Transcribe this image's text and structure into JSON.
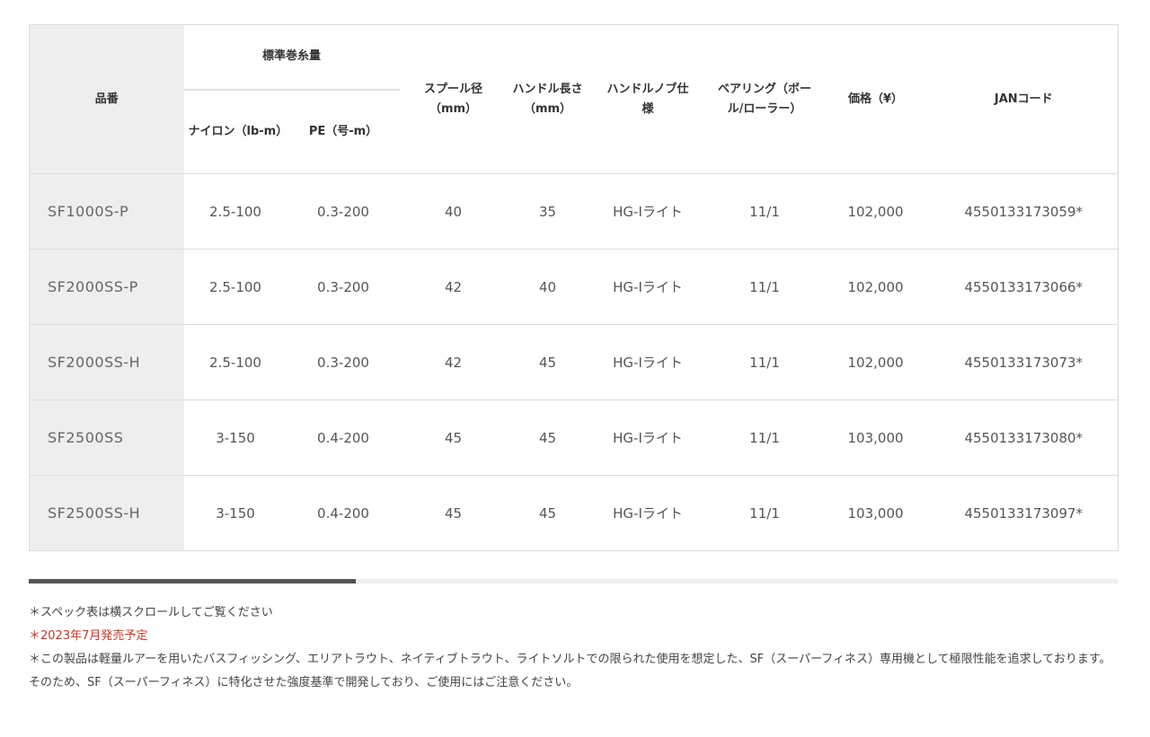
{
  "table": {
    "headers": {
      "model": "品番",
      "line_capacity": "標準巻糸量",
      "nylon": "ナイロン（lb-m）",
      "pe": "PE（号-m）",
      "spool": "スプール径（mm）",
      "handle_length": "ハンドル長さ（mm）",
      "knob": "ハンドルノブ仕様",
      "bearing": "ベアリング（ボール/ローラー）",
      "price": "価格（¥）",
      "jan": "JANコード"
    },
    "rows": [
      {
        "model": "SF1000S-P",
        "nylon": "2.5-100",
        "pe": "0.3-200",
        "spool": "40",
        "handle": "35",
        "knob": "HG-Iライト",
        "bearing": "11/1",
        "price": "102,000",
        "jan": "4550133173059*"
      },
      {
        "model": "SF2000SS-P",
        "nylon": "2.5-100",
        "pe": "0.3-200",
        "spool": "42",
        "handle": "40",
        "knob": "HG-Iライト",
        "bearing": "11/1",
        "price": "102,000",
        "jan": "4550133173066*"
      },
      {
        "model": "SF2000SS-H",
        "nylon": "2.5-100",
        "pe": "0.3-200",
        "spool": "42",
        "handle": "45",
        "knob": "HG-Iライト",
        "bearing": "11/1",
        "price": "102,000",
        "jan": "4550133173073*"
      },
      {
        "model": "SF2500SS",
        "nylon": "3-150",
        "pe": "0.4-200",
        "spool": "45",
        "handle": "45",
        "knob": "HG-Iライト",
        "bearing": "11/1",
        "price": "103,000",
        "jan": "4550133173080*"
      },
      {
        "model": "SF2500SS-H",
        "nylon": "3-150",
        "pe": "0.4-200",
        "spool": "45",
        "handle": "45",
        "knob": "HG-Iライト",
        "bearing": "11/1",
        "price": "103,000",
        "jan": "4550133173097*"
      }
    ]
  },
  "scrollbar": {
    "position": 0.3
  },
  "notes": {
    "scroll_hint": "＊スペック表は横スクロールしてご覧ください",
    "release": "＊2023年7月発売予定",
    "disclaimer": "＊この製品は軽量ルアーを用いたバスフィッシング、エリアトラウト、ネイティブトラウト、ライトソルトでの限られた使用を想定した、SF（スーパーフィネス）専用機として極限性能を追求しております。そのため、SF（スーパーフィネス）に特化させた強度基準で開発しており、ご使用にはご注意ください。"
  },
  "colors": {
    "model_bg": "#eeeeee",
    "border": "#dcdcdc",
    "note_red": "#c0392b",
    "scroll_thumb": "#555555"
  }
}
